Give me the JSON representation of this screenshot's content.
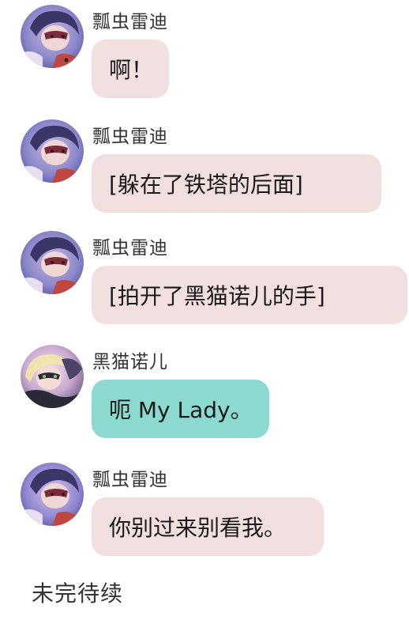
{
  "messages": [
    {
      "sender": "瓢虫雷迪",
      "text": "啊！",
      "style": "pink",
      "avatar": "ladybug-avatar"
    },
    {
      "sender": "瓢虫雷迪",
      "text": "[躲在了铁塔的后面]",
      "style": "pink",
      "avatar": "ladybug-avatar"
    },
    {
      "sender": "瓢虫雷迪",
      "text": "[拍开了黑猫诺儿的手]",
      "style": "pink",
      "avatar": "ladybug-avatar"
    },
    {
      "sender": "黑猫诺儿",
      "text": "呃 My Lady。",
      "style": "green",
      "avatar": "chat-noir-avatar"
    },
    {
      "sender": "瓢虫雷迪",
      "text": "你别过来别看我。",
      "style": "pink",
      "avatar": "ladybug-avatar"
    }
  ],
  "footer": {
    "text": "未完待续"
  },
  "colors": {
    "pink_bubble": "#f2e0e1",
    "green_bubble": "#8cd9cf",
    "text": "#1a1a1a",
    "sender_text": "#333333"
  }
}
